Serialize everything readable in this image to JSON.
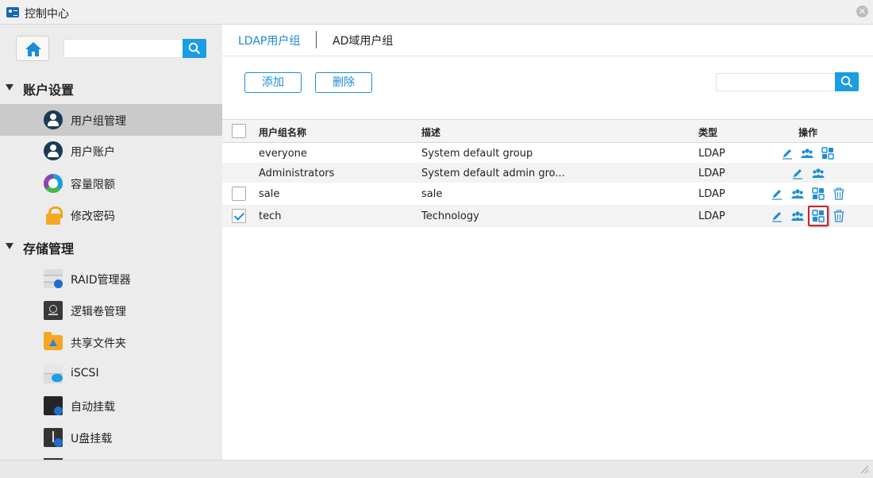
{
  "window": {
    "title": "控制中心",
    "close_symbol": "✕"
  },
  "sidebar": {
    "search_placeholder": "",
    "sections": [
      {
        "label": "账户设置",
        "items": [
          {
            "label": "用户组管理",
            "icon": "user-group-icon",
            "active": true
          },
          {
            "label": "用户账户",
            "icon": "user-account-icon"
          },
          {
            "label": "容量限额",
            "icon": "quota-icon"
          },
          {
            "label": "修改密码",
            "icon": "lock-icon"
          }
        ]
      },
      {
        "label": "存储管理",
        "items": [
          {
            "label": "RAID管理器",
            "icon": "raid-icon"
          },
          {
            "label": "逻辑卷管理",
            "icon": "lvm-icon"
          },
          {
            "label": "共享文件夹",
            "icon": "shared-folder-icon"
          },
          {
            "label": "iSCSI",
            "icon": "iscsi-icon"
          },
          {
            "label": "自动挂载",
            "icon": "auto-mount-icon"
          },
          {
            "label": "U盘挂载",
            "icon": "usb-mount-icon"
          }
        ]
      }
    ]
  },
  "tabs": [
    {
      "label": "LDAP用户组",
      "active": true
    },
    {
      "label": "AD域用户组",
      "active": false
    }
  ],
  "toolbar": {
    "add_label": "添加",
    "delete_label": "删除",
    "search_placeholder": ""
  },
  "table": {
    "headers": {
      "name": "用户组名称",
      "desc": "描述",
      "type": "类型",
      "ops": "操作"
    },
    "rows": [
      {
        "name": "everyone",
        "desc": "System default group",
        "type": "LDAP",
        "checkbox": false,
        "checked": false,
        "ops": [
          "edit-icon",
          "members-icon",
          "permissions-icon"
        ]
      },
      {
        "name": "Administrators",
        "desc": "System default admin gro...",
        "type": "LDAP",
        "checkbox": false,
        "checked": false,
        "ops": [
          "edit-icon",
          "members-icon"
        ]
      },
      {
        "name": "sale",
        "desc": "sale",
        "type": "LDAP",
        "checkbox": true,
        "checked": false,
        "ops": [
          "edit-icon",
          "members-icon",
          "permissions-icon",
          "delete-icon"
        ]
      },
      {
        "name": "tech",
        "desc": "Technology",
        "type": "LDAP",
        "checkbox": true,
        "checked": true,
        "ops": [
          "edit-icon",
          "members-icon",
          "permissions-icon",
          "delete-icon"
        ],
        "highlighted_op": "permissions-icon"
      }
    ]
  },
  "colors": {
    "accent": "#1b9de4",
    "link": "#1b8cd8",
    "highlight_border": "#c0282d",
    "sidebar_bg": "#ececec",
    "active_item_bg": "#cacaca"
  }
}
